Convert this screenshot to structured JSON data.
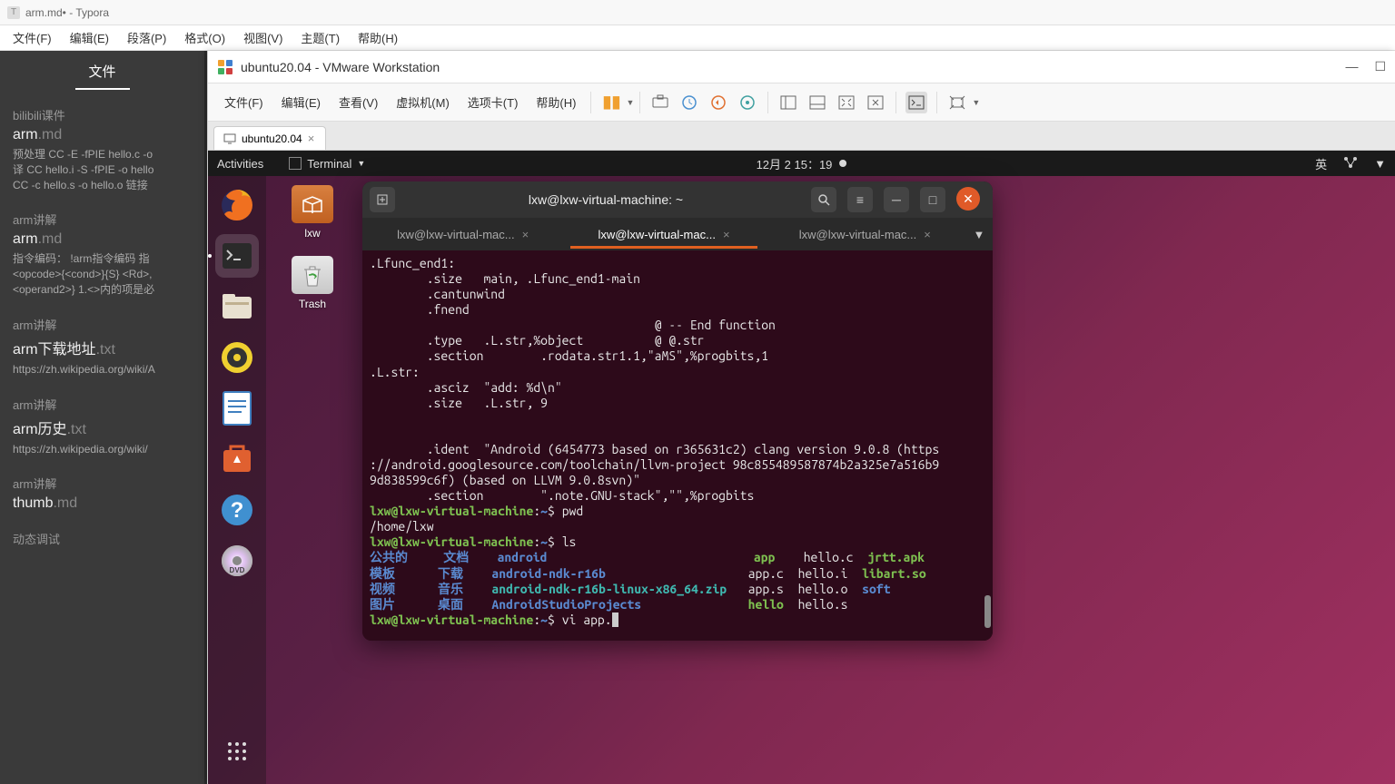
{
  "typora": {
    "title": "arm.md• - Typora",
    "menu": [
      "文件(F)",
      "编辑(E)",
      "段落(P)",
      "格式(O)",
      "视图(V)",
      "主题(T)",
      "帮助(H)"
    ],
    "sidebar_tab": "文件",
    "groups": [
      {
        "title": "bilibili课件",
        "name": "arm",
        "ext": ".md",
        "desc": "预处理 CC -E -fPIE hello.c -o\n译 CC hello.i -S -fPIE -o hello\nCC -c hello.s -o hello.o 链接"
      },
      {
        "title": "arm讲解",
        "name": "arm",
        "ext": ".md",
        "desc": "指令编码： !arm指令编码 指\n<opcode>{<cond>}{S} <Rd>,\n<operand2>} 1.<>内的项是必"
      },
      {
        "title": "arm讲解",
        "name": "arm下载地址",
        "ext": ".txt",
        "desc": "https://zh.wikipedia.org/wiki/A"
      },
      {
        "title": "arm讲解",
        "name": "arm历史",
        "ext": ".txt",
        "desc": "https://zh.wikipedia.org/wiki/"
      },
      {
        "title": "arm讲解",
        "name": "thumb",
        "ext": ".md",
        "desc": ""
      },
      {
        "title": "动态调试",
        "name": "",
        "ext": "",
        "desc": ""
      }
    ]
  },
  "vmware": {
    "title": "ubuntu20.04 - VMware Workstation",
    "menu": [
      "文件(F)",
      "编辑(E)",
      "查看(V)",
      "虚拟机(M)",
      "选项卡(T)",
      "帮助(H)"
    ],
    "tab": "ubuntu20.04"
  },
  "ubuntu": {
    "activities": "Activities",
    "terminal_ind": "Terminal",
    "datetime": "12月 2 15：19",
    "lang": "英",
    "desk_icons": [
      {
        "label": "lxw",
        "type": "folder"
      },
      {
        "label": "Trash",
        "type": "trash"
      }
    ]
  },
  "terminal": {
    "title": "lxw@lxw-virtual-machine: ~",
    "tabs": [
      "lxw@lxw-virtual-mac...",
      "lxw@lxw-virtual-mac...",
      "lxw@lxw-virtual-mac..."
    ],
    "active_tab": 1,
    "asm_output": ".Lfunc_end1:\n        .size   main, .Lfunc_end1-main\n        .cantunwind\n        .fnend\n                                        @ -- End function\n        .type   .L.str,%object          @ @.str\n        .section        .rodata.str1.1,\"aMS\",%progbits,1\n.L.str:\n        .asciz  \"add: %d\\n\"\n        .size   .L.str, 9\n\n\n        .ident  \"Android (6454773 based on r365631c2) clang version 9.0.8 (https\n://android.googlesource.com/toolchain/llvm-project 98c855489587874b2a325e7a516b9\n9d838599c6f) (based on LLVM 9.0.8svn)\"\n        .section        \".note.GNU-stack\",\"\",%progbits",
    "prompt_user": "lxw@lxw-virtual-machine",
    "prompt_path": "~",
    "cmd_pwd": "pwd",
    "pwd_out": "/home/lxw",
    "cmd_ls": "ls",
    "ls_rows": [
      {
        "c1": "公共的",
        "c2": "文档",
        "c3": "android",
        "c4": "app",
        "c5": "hello.c",
        "c6": "jrtt.apk",
        "cls4": "green",
        "cls5": "white",
        "cls6": "green"
      },
      {
        "c1": "模板",
        "c2": "下载",
        "c3": "android-ndk-r16b",
        "c4": "app.c",
        "c5": "hello.i",
        "c6": "libart.so",
        "cls4": "white",
        "cls5": "white",
        "cls6": "green"
      },
      {
        "c1": "视频",
        "c2": "音乐",
        "c3": "android-ndk-r16b-linux-x86_64.zip",
        "c4": "app.s",
        "c5": "hello.o",
        "c6": "soft",
        "cls3": "cyan",
        "cls4": "white",
        "cls5": "white",
        "cls6": "blue"
      },
      {
        "c1": "图片",
        "c2": "桌面",
        "c3": "AndroidStudioProjects",
        "c4": "hello",
        "c5": "hello.s",
        "c6": "",
        "cls4": "green",
        "cls5": "white"
      }
    ],
    "cmd_current": "vi app."
  }
}
